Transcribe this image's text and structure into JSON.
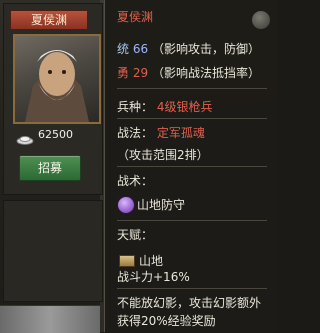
{
  "left_card": {
    "name": "夏侯渊",
    "gold": "62500",
    "recruit_label": "招募"
  },
  "tooltip": {
    "title": "夏侯渊",
    "stats": [
      {
        "label": "统",
        "value": "66",
        "desc": "（影响攻击，防御）"
      },
      {
        "label": "勇",
        "value": "29",
        "desc": "（影响战法抵挡率）"
      }
    ],
    "soldier_label": "兵种：",
    "soldier_value": "4级银枪兵",
    "tactic_label": "战法：",
    "tactic_value": "定军孤魂",
    "tactic_range": "（攻击范围2排）",
    "strategy_label": "战术：",
    "strategy_value": "山地防守",
    "talent_label": "天赋：",
    "talent_terrain": "山地",
    "talent_bonus": "战斗力+16%",
    "note_line1": "不能放幻影，攻击幻影额外",
    "note_line2": "获得20%经验奖励"
  },
  "colors": {
    "title_red": "#e0604d",
    "stat_blue": "#9fb6ff"
  }
}
